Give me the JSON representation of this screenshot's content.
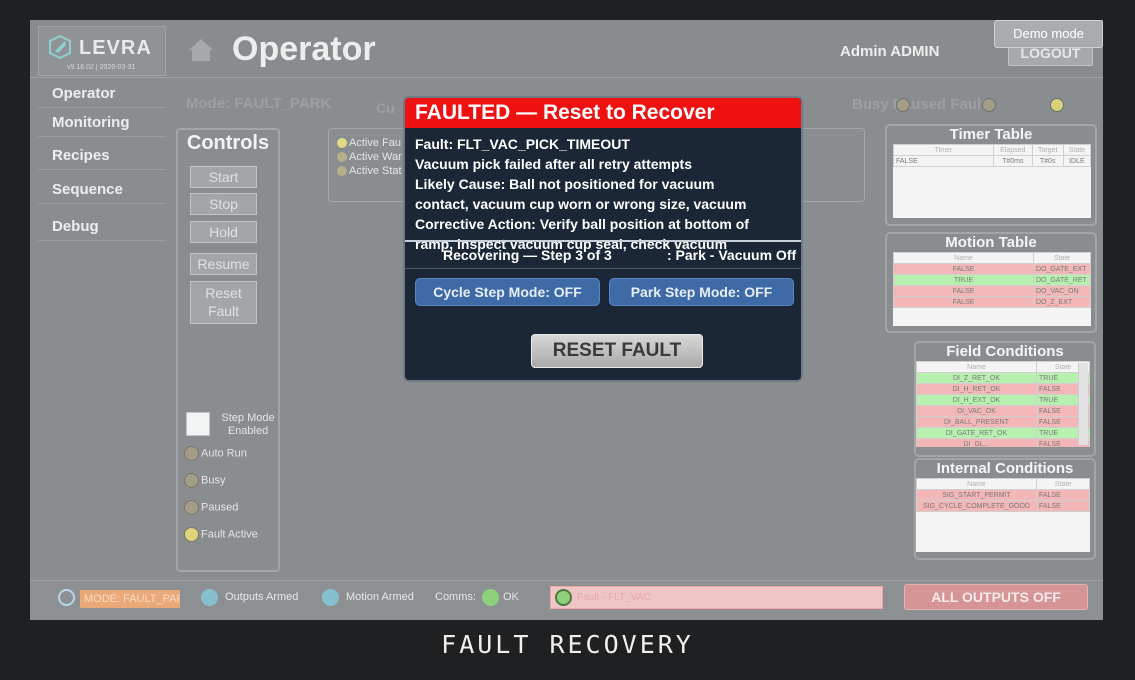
{
  "header": {
    "logo_text": "LEVRA",
    "logo_version": "v9.16.02 | 2026-03-31",
    "page_title": "Operator",
    "user_label": "Admin  ADMIN",
    "logout_label": "LOGOUT",
    "demo_mode_label": "Demo mode"
  },
  "sidebar": {
    "items": [
      {
        "label": "Operator"
      },
      {
        "label": "Monitoring"
      },
      {
        "label": "Recipes"
      },
      {
        "label": "Sequence"
      },
      {
        "label": "Debug"
      }
    ]
  },
  "mode_line": {
    "mode": "Mode: FAULT_PARK",
    "cu": "Cu",
    "status": "Busy   Paused   Fault"
  },
  "controls": {
    "title": "Controls",
    "buttons": {
      "start": "Start",
      "stop": "Stop",
      "hold": "Hold",
      "resume": "Resume",
      "reset_fault_1": "Reset",
      "reset_fault_2": "Fault"
    },
    "step_mode_label_1": "Step Mode",
    "step_mode_label_2": "Enabled",
    "indicators": {
      "auto_run": "Auto Run",
      "busy": "Busy",
      "paused": "Paused",
      "fault_active": "Fault Active"
    }
  },
  "active_box": {
    "line1": "Active Fau",
    "line2": "Active War",
    "line3": "Active Stat"
  },
  "timer_table": {
    "title": "Timer Table",
    "headers": [
      "Timer",
      "Elapsed",
      "Target",
      "State"
    ],
    "rows": [
      [
        "FALSE",
        "T#0ms",
        "T#0s",
        "IDLE"
      ]
    ]
  },
  "motion_table": {
    "title": "Motion Table",
    "headers": [
      "Name",
      "State"
    ],
    "rows": [
      {
        "value": "FALSE",
        "name": "DO_GATE_EXT",
        "color": "red"
      },
      {
        "value": "TRUE",
        "name": "DO_GATE_RET",
        "color": "green"
      },
      {
        "value": "FALSE",
        "name": "DO_VAC_ON",
        "color": "red"
      },
      {
        "value": "FALSE",
        "name": "DO_Z_EXT",
        "color": "red"
      }
    ]
  },
  "field_conditions": {
    "title": "Field Conditions",
    "headers": [
      "Name",
      "State"
    ],
    "rows": [
      {
        "name": "DI_Z_RET_OK",
        "value": "TRUE",
        "color": "green"
      },
      {
        "name": "DI_H_RET_OK",
        "value": "FALSE",
        "color": "red"
      },
      {
        "name": "DI_H_EXT_OK",
        "value": "TRUE",
        "color": "green"
      },
      {
        "name": "DI_VAC_OK",
        "value": "FALSE",
        "color": "red"
      },
      {
        "name": "DI_BALL_PRESENT",
        "value": "FALSE",
        "color": "red"
      },
      {
        "name": "DI_GATE_RET_OK",
        "value": "TRUE",
        "color": "green"
      },
      {
        "name": "DI_GL...",
        "value": "FALSE",
        "color": "red"
      }
    ]
  },
  "internal_conditions": {
    "title": "Internal Conditions",
    "headers": [
      "Name",
      "State"
    ],
    "rows": [
      {
        "name": "SIG_START_PERMIT",
        "value": "FALSE",
        "color": "red"
      },
      {
        "name": "SIG_CYCLE_COMPLETE_GOOD",
        "value": "FALSE",
        "color": "red"
      }
    ]
  },
  "bottom_bar": {
    "mode": "MODE: FAULT_PAR",
    "outputs_armed": "Outputs Armed",
    "motion_armed": "Motion Armed",
    "comms_label": "Comms:",
    "comms_value": "OK",
    "fault_text": "Fault - FLT_VAC",
    "all_outputs_off": "ALL OUTPUTS OFF"
  },
  "dialog": {
    "title": "FAULTED — Reset to Recover",
    "fault_code": "Fault: FLT_VAC_PICK_TIMEOUT",
    "description": "Vacuum pick failed after all retry attempts",
    "cause_1": "Likely Cause: Ball not positioned for vacuum",
    "cause_2": "contact, vacuum cup worn or wrong size, vacuum",
    "action_1": "Corrective Action: Verify ball position at bottom of",
    "action_2": "ramp, inspect vacuum cup seal, check vacuum",
    "step": "Recovering — Step 3 of 3",
    "park": ": Park - Vacuum Off",
    "cycle_step_mode": "Cycle Step Mode: OFF",
    "park_step_mode": "Park Step Mode: OFF",
    "reset_label": "RESET FAULT"
  },
  "caption": "FAULT RECOVERY",
  "colors": {
    "fault_red": "#ee1111",
    "dialog_bg": "#1b2736",
    "mode_button_blue": "#3e6aa6",
    "mode_orange": "#e9a979"
  }
}
